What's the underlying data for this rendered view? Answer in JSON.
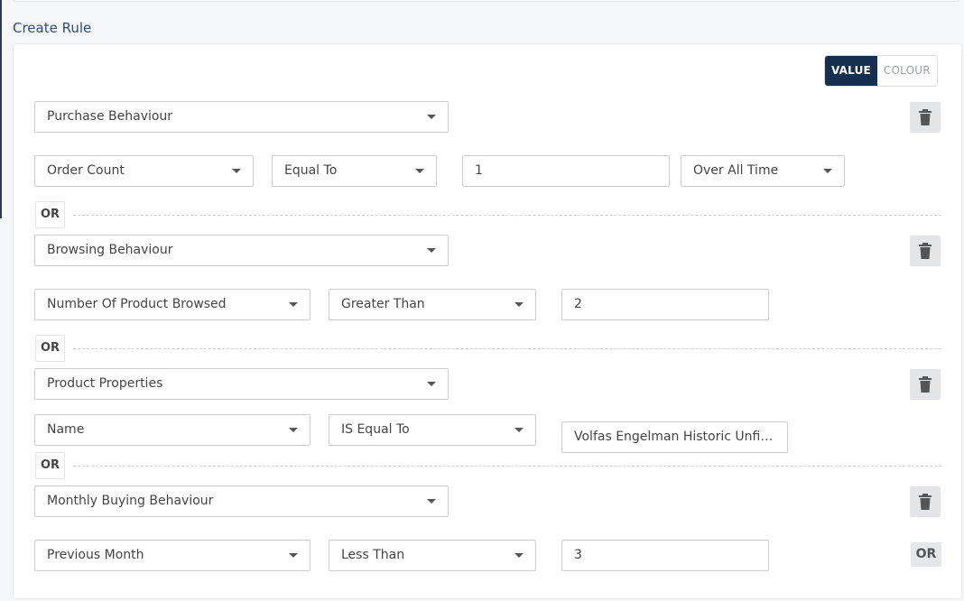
{
  "section_title": "Create Rule",
  "mode_toggle": {
    "value_label": "VALUE",
    "colour_label": "COLOUR",
    "active": "VALUE"
  },
  "or_label": "OR",
  "rules": [
    {
      "category": "Purchase Behaviour",
      "field": "Order Count",
      "operator": "Equal To",
      "value": "1",
      "period": "Over All Time"
    },
    {
      "category": "Browsing Behaviour",
      "field": "Number Of Product Browsed",
      "operator": "Greater Than",
      "value": "2"
    },
    {
      "category": "Product Properties",
      "field": "Name",
      "operator": "IS Equal To",
      "value": "Volfas Engelman Historic Unfiltered"
    },
    {
      "category": "Monthly Buying Behaviour",
      "field": "Previous Month",
      "operator": "Less Than",
      "value": "3"
    }
  ],
  "add_or_button": "OR",
  "icons": {
    "delete": "trash-icon",
    "dropdown": "caret-down-icon"
  }
}
